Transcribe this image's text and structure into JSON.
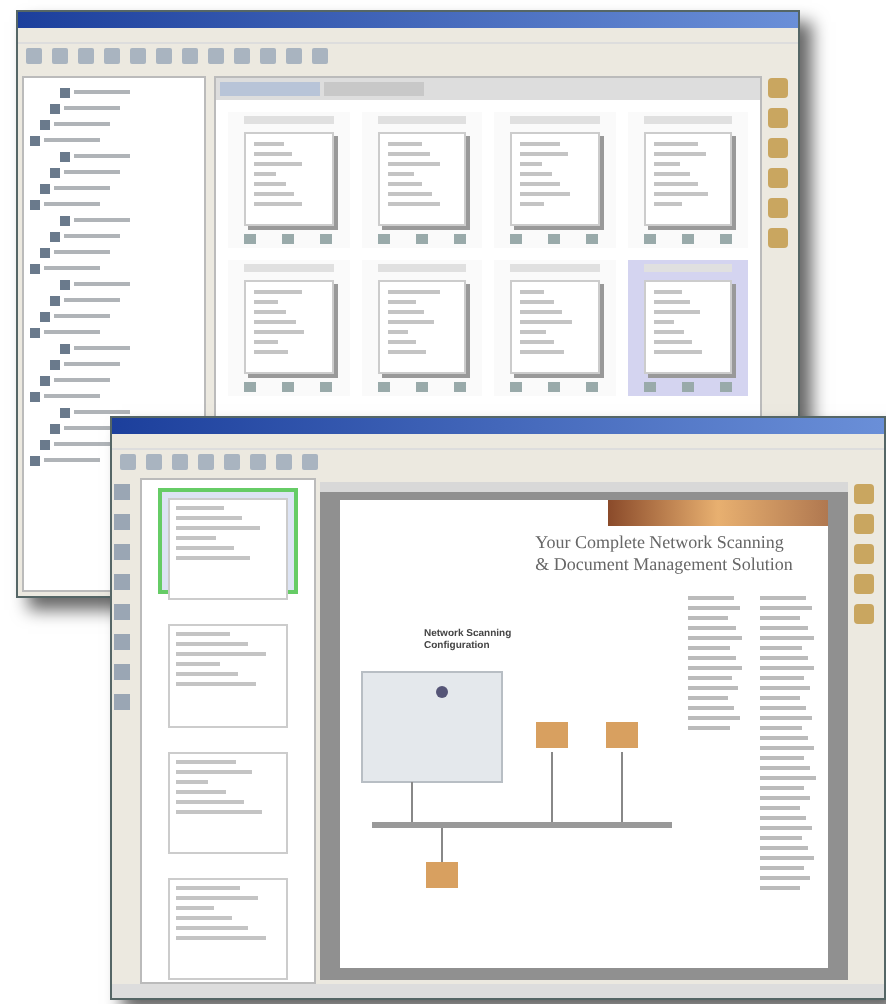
{
  "back_window": {
    "thumbnails": [
      {
        "selected": false
      },
      {
        "selected": false
      },
      {
        "selected": false
      },
      {
        "selected": false
      },
      {
        "selected": false
      },
      {
        "selected": false
      },
      {
        "selected": false
      },
      {
        "selected": true
      }
    ]
  },
  "front_window": {
    "page_thumbnails": [
      {
        "selected": true
      },
      {
        "selected": false
      },
      {
        "selected": false
      },
      {
        "selected": false
      }
    ],
    "document": {
      "heading": [
        "Your Complete Network Scanning",
        "& Document Management Solution"
      ],
      "diagram_title": [
        "Network Scanning",
        "Configuration"
      ]
    }
  }
}
